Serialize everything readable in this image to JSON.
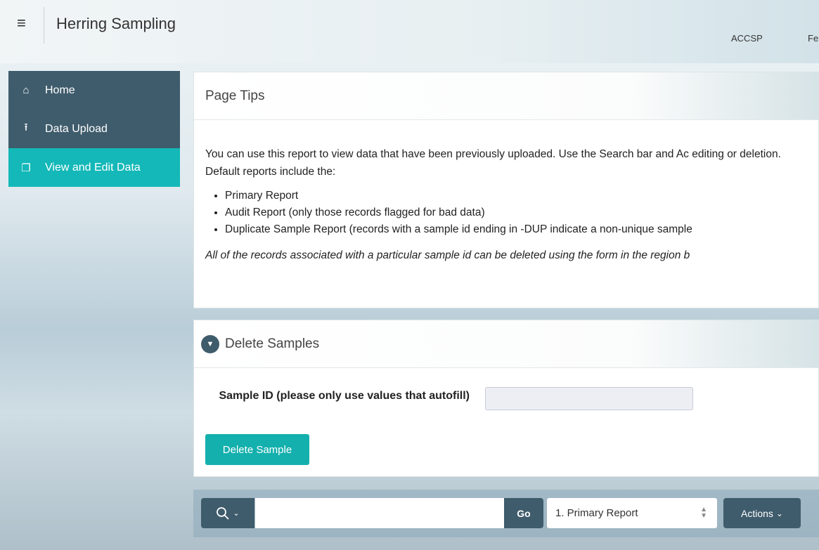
{
  "header": {
    "menu_icon": "hamburger-icon",
    "title": "Herring Sampling",
    "links": [
      "ACCSP",
      "Fe"
    ]
  },
  "sidebar": {
    "items": [
      {
        "label": "Home",
        "icon": "home-icon",
        "glyph": "⌂"
      },
      {
        "label": "Data Upload",
        "icon": "upload-icon",
        "glyph": "⭱"
      },
      {
        "label": "View and Edit Data",
        "icon": "copy-icon",
        "glyph": "❐",
        "active": true
      }
    ]
  },
  "tips": {
    "title": "Page Tips",
    "intro": "You can use this report to view data that have been previously uploaded. Use the Search bar and Ac editing or deletion. Default reports include the:",
    "bullets": [
      "Primary Report",
      "Audit Report (only those records flagged for bad data)",
      "Duplicate Sample Report (records with a sample id ending in -DUP indicate a non-unique sample"
    ],
    "note": "All of the records associated with a particular sample id can be deleted using the form in the region b"
  },
  "delete_samples": {
    "title": "Delete Samples",
    "field_label": "Sample ID (please only use values that autofill)",
    "field_value": "",
    "button_label": "Delete Sample"
  },
  "toolbar": {
    "search_value": "",
    "go_label": "Go",
    "report_selected": "1. Primary Report",
    "actions_label": "Actions"
  },
  "colors": {
    "sidebar_dark": "#3f5c6c",
    "accent_teal": "#14b8b8"
  }
}
